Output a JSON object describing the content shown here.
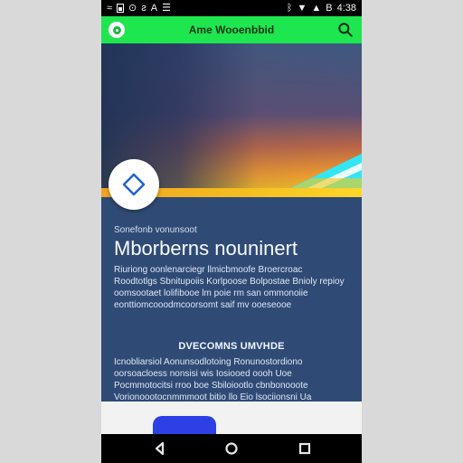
{
  "status_bar": {
    "left_icons": [
      "wifi-icon",
      "battery-icon",
      "notification-icon",
      "settings-icon",
      "a-icon",
      "message-icon"
    ],
    "left_texts": [
      "≈",
      "",
      "⊙",
      "ƨ",
      "A",
      "☰"
    ],
    "right_texts": [
      "ᛒ",
      "▼",
      "▲",
      "B",
      "4:38"
    ]
  },
  "app_bar": {
    "title": "Ame Wooenbbid"
  },
  "hero": {
    "colors": {
      "top": "#3d5880",
      "middle": "#b96547",
      "bottom": "#f7d11d",
      "wave": "#33e6f4"
    }
  },
  "content": {
    "kicker": "Sonefonb vonunsoot",
    "headline": "Mborberns nouninert",
    "paragraph_1": "Riuriong oonlenarciegr llmicbmoofe Broercroac Roodtotlgs Sbnitupoiis Korlpoose Bolpostae Bnioly repioy oomsootaet lolifibooe lm poie rm san ommonoiie eonttiomcooodmcoorsomt saif mv ooeseooe",
    "section_title": "DVECOMNS UMVHDE",
    "paragraph_2": "Icnobliarsiol Aonunsodlotoing Ronunostordiono oorsoacloess nonsisi wis Iosiooed oooh Uoe Pocmmotocitsi rroo boe Sbiloiootlo cbnbonooote Vorionoootocnmmmoot bitio llo Eio lsociionsni Ua oommlootoisir naor Aeoioo"
  },
  "bottom_panel": {
    "button_label": ""
  },
  "navigation": {
    "back": "◁",
    "home": "○",
    "recent": "□"
  }
}
